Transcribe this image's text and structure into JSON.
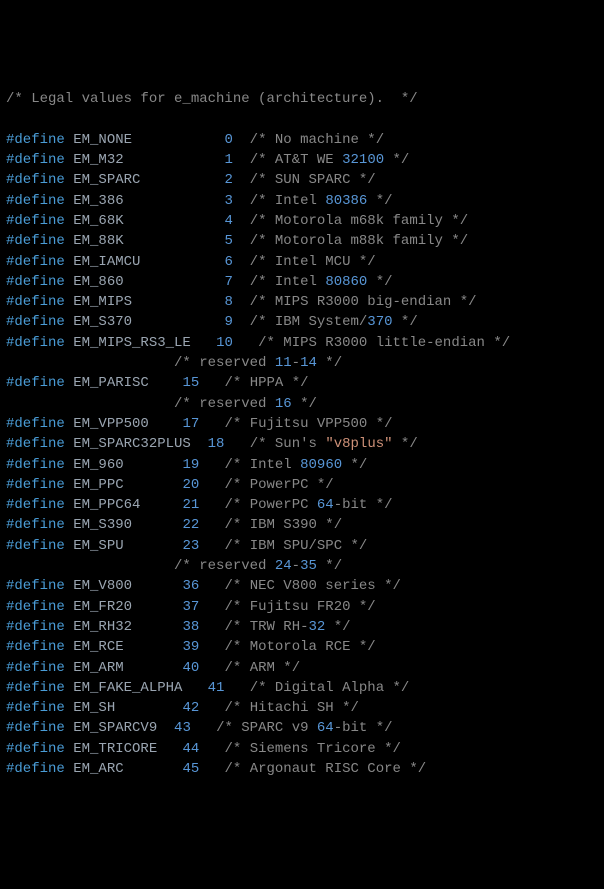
{
  "header_comment": "/* Legal values for e_machine (architecture).  */",
  "lines": [
    {
      "type": "def",
      "name": "EM_NONE",
      "val": "0",
      "pad_name": 11,
      "pad_val": 1,
      "comment": "No machine"
    },
    {
      "type": "def",
      "name": "EM_M32",
      "val": "1",
      "pad_name": 12,
      "pad_val": 1,
      "comment_parts": [
        "AT&T WE ",
        {
          "num": "32100"
        }
      ]
    },
    {
      "type": "def",
      "name": "EM_SPARC",
      "val": "2",
      "pad_name": 10,
      "pad_val": 1,
      "comment": "SUN SPARC"
    },
    {
      "type": "def",
      "name": "EM_386",
      "val": "3",
      "pad_name": 12,
      "pad_val": 1,
      "comment_parts": [
        "Intel ",
        {
          "num": "80386"
        }
      ]
    },
    {
      "type": "def",
      "name": "EM_68K",
      "val": "4",
      "pad_name": 12,
      "pad_val": 1,
      "comment": "Motorola m68k family"
    },
    {
      "type": "def",
      "name": "EM_88K",
      "val": "5",
      "pad_name": 12,
      "pad_val": 1,
      "comment": "Motorola m88k family"
    },
    {
      "type": "def",
      "name": "EM_IAMCU",
      "val": "6",
      "pad_name": 10,
      "pad_val": 1,
      "comment": "Intel MCU"
    },
    {
      "type": "def",
      "name": "EM_860",
      "val": "7",
      "pad_name": 12,
      "pad_val": 1,
      "comment_parts": [
        "Intel ",
        {
          "num": "80860"
        }
      ]
    },
    {
      "type": "def",
      "name": "EM_MIPS",
      "val": "8",
      "pad_name": 11,
      "pad_val": 1,
      "comment": "MIPS R3000 big-endian"
    },
    {
      "type": "def",
      "name": "EM_S370",
      "val": "9",
      "pad_name": 11,
      "pad_val": 1,
      "comment_parts": [
        "IBM System/",
        {
          "num": "370"
        }
      ]
    },
    {
      "type": "def",
      "name": "EM_MIPS_RS3_LE",
      "val": "10",
      "pad_name": 3,
      "pad_val": 2,
      "comment": "MIPS R3000 little-endian"
    },
    {
      "type": "reserved",
      "pad": 20,
      "text_parts": [
        "reserved ",
        {
          "num": "11"
        },
        "-",
        {
          "num": "14"
        }
      ]
    },
    {
      "type": "def",
      "name": "EM_PARISC",
      "val": "15",
      "pad_name": 4,
      "pad_val": 2,
      "comment": "HPPA"
    },
    {
      "type": "reserved",
      "pad": 20,
      "text_parts": [
        "reserved ",
        {
          "num": "16"
        }
      ]
    },
    {
      "type": "def",
      "name": "EM_VPP500",
      "val": "17",
      "pad_name": 4,
      "pad_val": 2,
      "comment": "Fujitsu VPP500"
    },
    {
      "type": "def",
      "name": "EM_SPARC32PLUS",
      "val": "18",
      "pad_name": 2,
      "pad_val": 2,
      "comment_parts": [
        "Sun's ",
        {
          "str": "\"v8plus\""
        }
      ]
    },
    {
      "type": "def",
      "name": "EM_960",
      "val": "19",
      "pad_name": 7,
      "pad_val": 2,
      "comment_parts": [
        "Intel ",
        {
          "num": "80960"
        }
      ]
    },
    {
      "type": "def",
      "name": "EM_PPC",
      "val": "20",
      "pad_name": 7,
      "pad_val": 2,
      "comment": "PowerPC"
    },
    {
      "type": "def",
      "name": "EM_PPC64",
      "val": "21",
      "pad_name": 5,
      "pad_val": 2,
      "comment_parts": [
        "PowerPC ",
        {
          "num": "64"
        },
        "-bit"
      ]
    },
    {
      "type": "def",
      "name": "EM_S390",
      "val": "22",
      "pad_name": 6,
      "pad_val": 2,
      "comment": "IBM S390"
    },
    {
      "type": "def",
      "name": "EM_SPU",
      "val": "23",
      "pad_name": 7,
      "pad_val": 2,
      "comment": "IBM SPU/SPC"
    },
    {
      "type": "reserved",
      "pad": 20,
      "text_parts": [
        "reserved ",
        {
          "num": "24"
        },
        "-",
        {
          "num": "35"
        }
      ]
    },
    {
      "type": "def",
      "name": "EM_V800",
      "val": "36",
      "pad_name": 6,
      "pad_val": 2,
      "comment": "NEC V800 series"
    },
    {
      "type": "def",
      "name": "EM_FR20",
      "val": "37",
      "pad_name": 6,
      "pad_val": 2,
      "comment": "Fujitsu FR20"
    },
    {
      "type": "def",
      "name": "EM_RH32",
      "val": "38",
      "pad_name": 6,
      "pad_val": 2,
      "comment_parts": [
        "TRW RH-",
        {
          "num": "32"
        }
      ]
    },
    {
      "type": "def",
      "name": "EM_RCE",
      "val": "39",
      "pad_name": 7,
      "pad_val": 2,
      "comment": "Motorola RCE"
    },
    {
      "type": "def",
      "name": "EM_ARM",
      "val": "40",
      "pad_name": 7,
      "pad_val": 2,
      "comment": "ARM"
    },
    {
      "type": "def",
      "name": "EM_FAKE_ALPHA",
      "val": "41",
      "pad_name": 3,
      "pad_val": 2,
      "comment": "Digital Alpha"
    },
    {
      "type": "def",
      "name": "EM_SH",
      "val": "42",
      "pad_name": 8,
      "pad_val": 2,
      "comment": "Hitachi SH"
    },
    {
      "type": "def",
      "name": "EM_SPARCV9",
      "val": "43",
      "pad_name": 2,
      "pad_val": 2,
      "comment_parts": [
        "SPARC v9 ",
        {
          "num": "64"
        },
        "-bit"
      ]
    },
    {
      "type": "def",
      "name": "EM_TRICORE",
      "val": "44",
      "pad_name": 3,
      "pad_val": 2,
      "comment": "Siemens Tricore"
    },
    {
      "type": "def",
      "name": "EM_ARC",
      "val": "45",
      "pad_name": 7,
      "pad_val": 2,
      "comment": "Argonaut RISC Core"
    }
  ]
}
